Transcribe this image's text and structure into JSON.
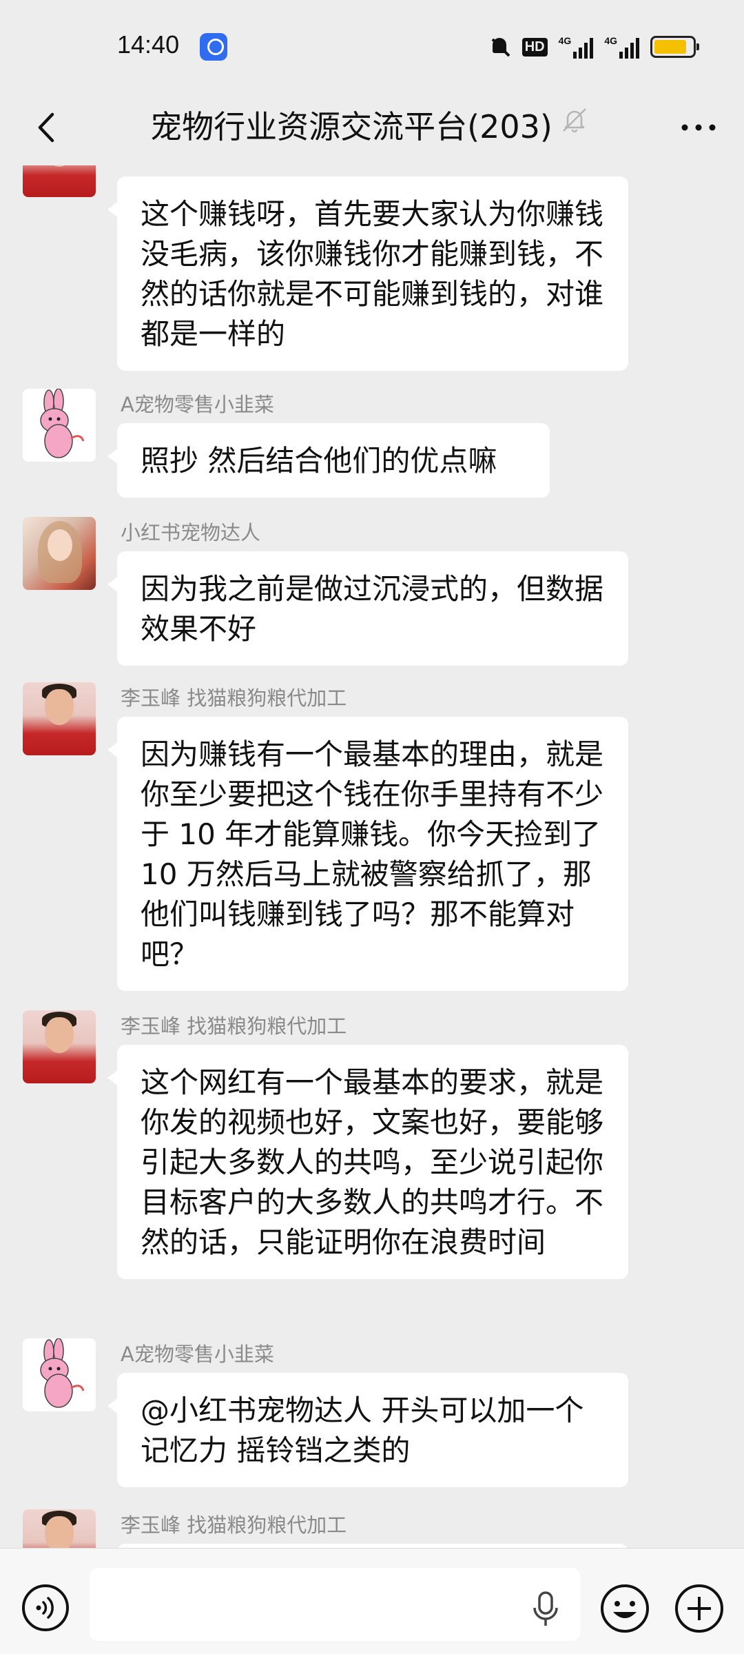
{
  "status_bar": {
    "time": "14:40",
    "hd_label": "HD",
    "signal1_label": "4G",
    "signal2_label": "4G",
    "battery_level": 0.85,
    "battery_color": "#f5c000"
  },
  "header": {
    "title": "宠物行业资源交流平台(203)"
  },
  "messages": [
    {
      "sender": "",
      "avatar": "man",
      "text": "这个赚钱呀，首先要大家认为你赚钱没毛病，该你赚钱你才能赚到钱，不然的话你就是不可能赚到钱的，对谁都是一样的"
    },
    {
      "sender": "A宠物零售小韭菜",
      "avatar": "rabbit",
      "text": "照抄 然后结合他们的优点嘛"
    },
    {
      "sender": "小红书宠物达人",
      "avatar": "girl",
      "text": "因为我之前是做过沉浸式的，但数据效果不好"
    },
    {
      "sender": "李玉峰 找猫粮狗粮代加工",
      "avatar": "man",
      "text": "因为赚钱有一个最基本的理由，就是你至少要把这个钱在你手里持有不少于 10 年才能算赚钱。你今天捡到了 10 万然后马上就被警察给抓了，那他们叫钱赚到钱了吗？那不能算对吧？"
    },
    {
      "sender": "李玉峰 找猫粮狗粮代加工",
      "avatar": "man",
      "text": "这个网红有一个最基本的要求，就是你发的视频也好，文案也好，要能够引起大多数人的共鸣，至少说引起你目标客户的大多数人的共鸣才行。不然的话，只能证明你在浪费时间"
    },
    {
      "sender": "A宠物零售小韭菜",
      "avatar": "rabbit",
      "text": "@小红书宠物达人  开头可以加一个记忆力 摇铃铛之类的"
    },
    {
      "sender": "李玉峰 找猫粮狗粮代加工",
      "avatar": "man",
      "text": ""
    }
  ],
  "input_bar": {
    "placeholder": ""
  },
  "colors": {
    "background": "#ededed",
    "bubble": "#ffffff",
    "sender_text": "#8a8a8a"
  }
}
